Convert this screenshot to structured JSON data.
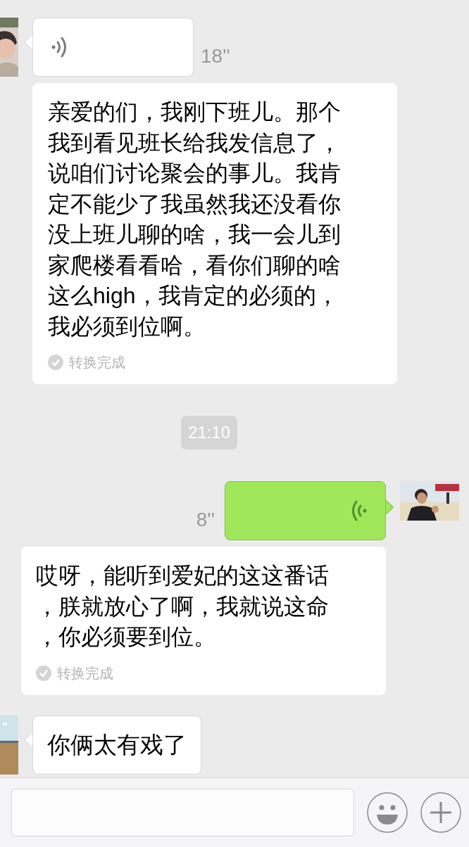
{
  "messages": [
    {
      "kind": "voice",
      "outgoing": false,
      "duration": "18''"
    },
    {
      "kind": "transcript",
      "outgoing": false,
      "text": "亲爱的们，我刚下班儿。那个我到看见班长给我发信息了，说咱们讨论聚会的事儿。我肯定不能少了我虽然我还没看你没上班儿聊的啥，我一会儿到家爬楼看看哈，看你们聊的啥这么high，我肯定的必须的，我必须到位啊。",
      "status": "转换完成"
    },
    {
      "kind": "time",
      "text": "21:10"
    },
    {
      "kind": "voice",
      "outgoing": true,
      "duration": "8''"
    },
    {
      "kind": "transcript",
      "outgoing": true,
      "text": "哎呀，能听到爱妃的这这番话，朕就放心了啊，我就说这命，你必须要到位。",
      "status": "转换完成"
    },
    {
      "kind": "text",
      "outgoing": false,
      "text": "你俩太有戏了"
    }
  ],
  "composer": {
    "kind": "voice-less"
  }
}
